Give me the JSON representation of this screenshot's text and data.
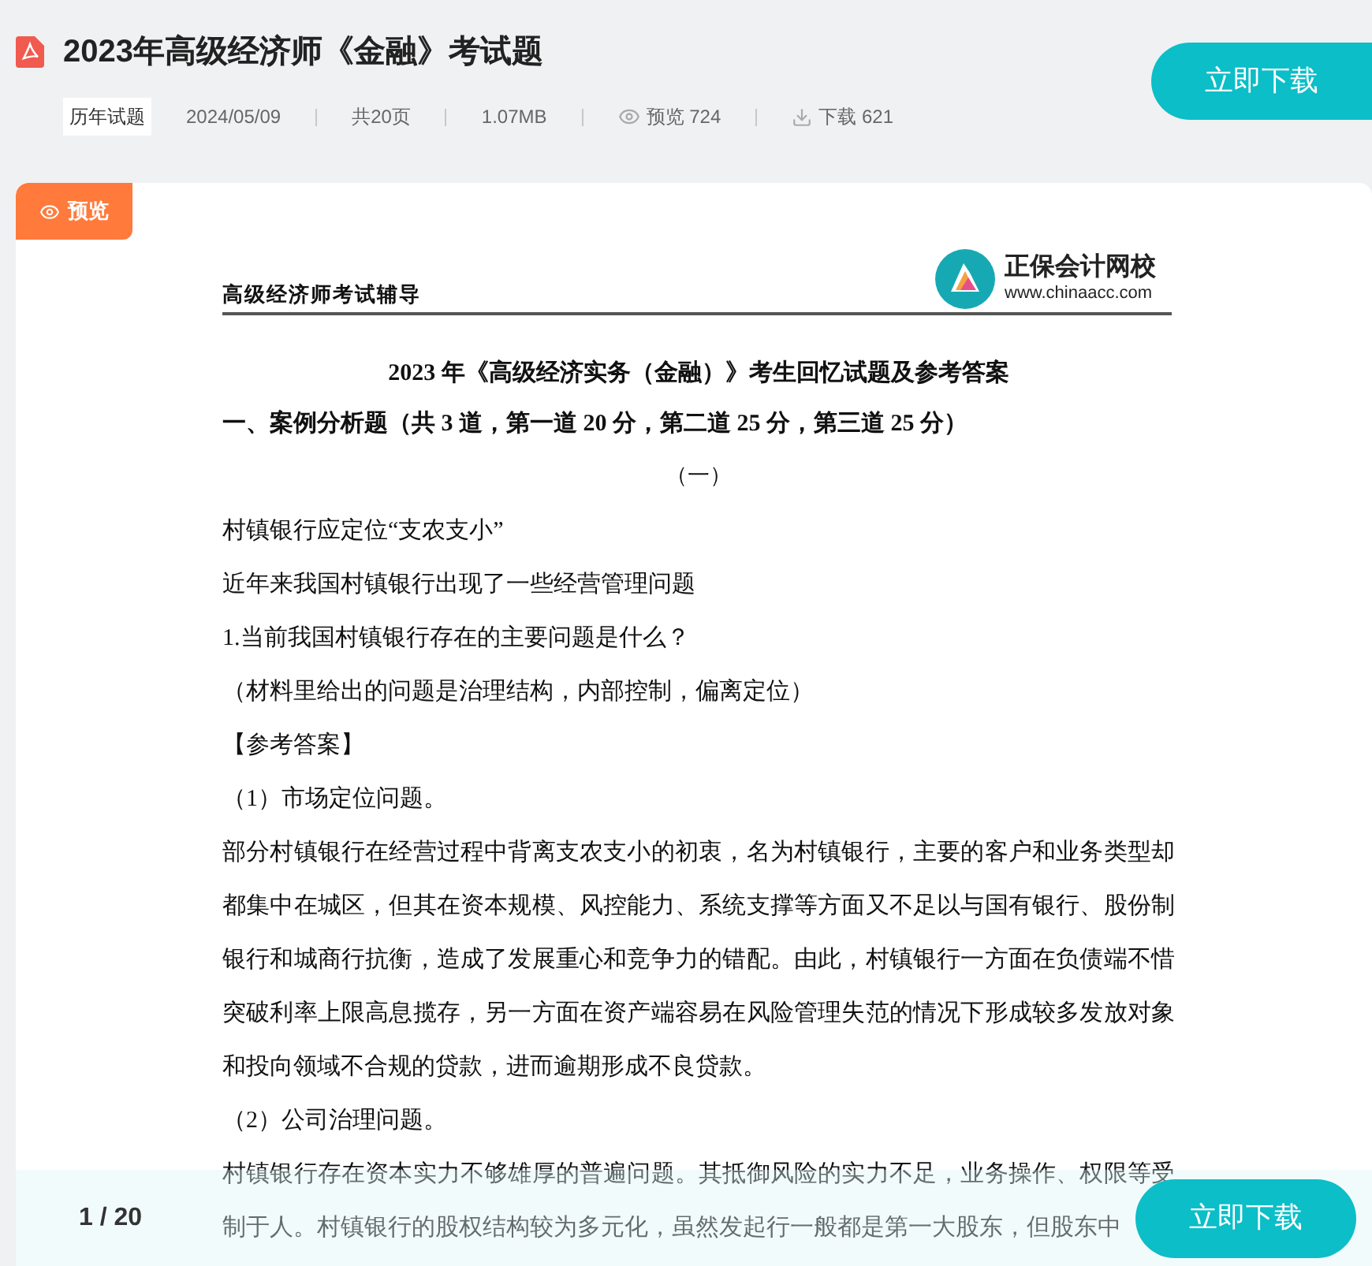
{
  "header": {
    "title": "2023年高级经济师《金融》考试题",
    "category": "历年试题",
    "date": "2024/05/09",
    "pages": "共20页",
    "size": "1.07MB",
    "views": "预览 724",
    "downloads": "下载 621",
    "download_button": "立即下载"
  },
  "preview_badge": "预览",
  "document": {
    "running_head": "高级经济师考试辅导",
    "logo_name": "正保会计网校",
    "logo_url": "www.chinaacc.com",
    "blocks": [
      {
        "kind": "title",
        "text": "2023 年《高级经济实务（金融）》考生回忆试题及参考答案"
      },
      {
        "kind": "heading",
        "text": "一、案例分析题（共 3 道，第一道 20 分，第二道 25 分，第三道 25 分）"
      },
      {
        "kind": "center",
        "text": "（一）"
      },
      {
        "kind": "para",
        "text": "村镇银行应定位“支农支小”"
      },
      {
        "kind": "para",
        "text": "近年来我国村镇银行出现了一些经营管理问题"
      },
      {
        "kind": "para",
        "text": "1.当前我国村镇银行存在的主要问题是什么？"
      },
      {
        "kind": "para",
        "text": "（材料里给出的问题是治理结构，内部控制，偏离定位）"
      },
      {
        "kind": "para",
        "text": "【参考答案】"
      },
      {
        "kind": "para",
        "text": "（1）市场定位问题。"
      },
      {
        "kind": "para",
        "text": "部分村镇银行在经营过程中背离支农支小的初衷，名为村镇银行，主要的客户和业务类型却都集中在城区，但其在资本规模、风控能力、系统支撑等方面又不足以与国有银行、股份制银行和城商行抗衡，造成了发展重心和竞争力的错配。由此，村镇银行一方面在负债端不惜突破利率上限高息揽存，另一方面在资产端容易在风险管理失范的情况下形成较多发放对象和投向领域不合规的贷款，进而逾期形成不良贷款。"
      },
      {
        "kind": "para",
        "text": "（2）公司治理问题。"
      },
      {
        "kind": "para",
        "text": "村镇银行存在资本实力不够雄厚的普遍问题。其抵御风险的实力不足，业务操作、权限等受制于人。村镇银行的股权结构较为多元化，虽然发起行一般都是第一大股东，但股东中"
      }
    ]
  },
  "footer": {
    "page_indicator": "1 / 20",
    "download_button": "立即下载"
  }
}
